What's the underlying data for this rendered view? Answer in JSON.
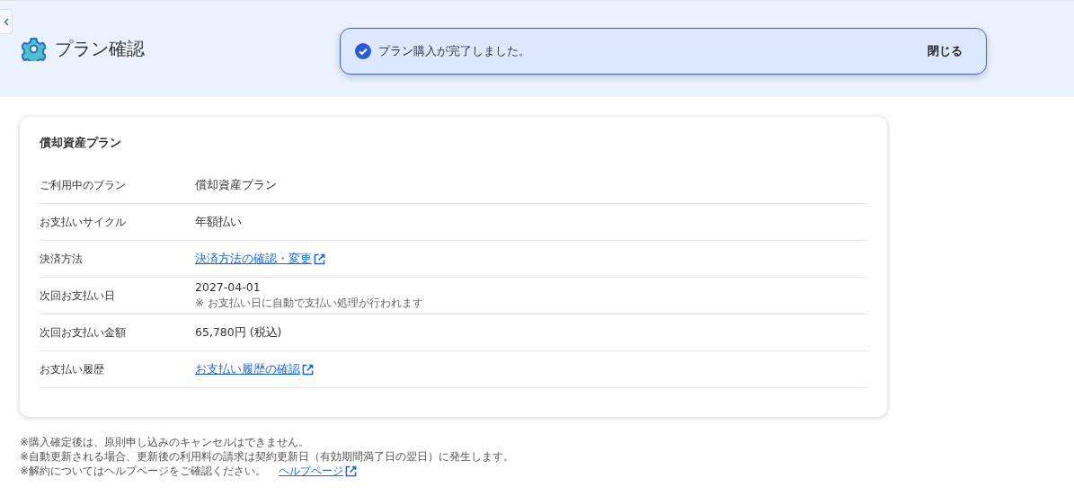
{
  "header": {
    "title": "プラン確認"
  },
  "toast": {
    "message": "プラン購入が完了しました。",
    "close": "閉じる"
  },
  "card": {
    "title": "償却資産プラン",
    "rows": [
      {
        "kind": "text",
        "label": "ご利用中のプラン",
        "value": "償却資産プラン"
      },
      {
        "kind": "text",
        "label": "お支払いサイクル",
        "value": "年額払い"
      },
      {
        "kind": "link",
        "label": "決済方法",
        "value": "決済方法の確認・変更"
      },
      {
        "kind": "note",
        "label": "次回お支払い日",
        "value": "2027-04-01",
        "note": "※ お支払い日に自動で支払い処理が行われます"
      },
      {
        "kind": "text",
        "label": "次回お支払い金額",
        "value": "65,780円 (税込)"
      },
      {
        "kind": "link",
        "label": "お支払い履歴",
        "value": "お支払い履歴の確認"
      }
    ]
  },
  "notes": [
    {
      "text": "※購入確定後は、原則申し込みのキャンセルはできません。"
    },
    {
      "text": "※自動更新される場合、更新後の利用料の請求は契約更新日（有効期間満了日の翌日）に発生します。"
    },
    {
      "text": "※解約についてはヘルプページをご確認ください。",
      "link": "ヘルプページ"
    }
  ]
}
